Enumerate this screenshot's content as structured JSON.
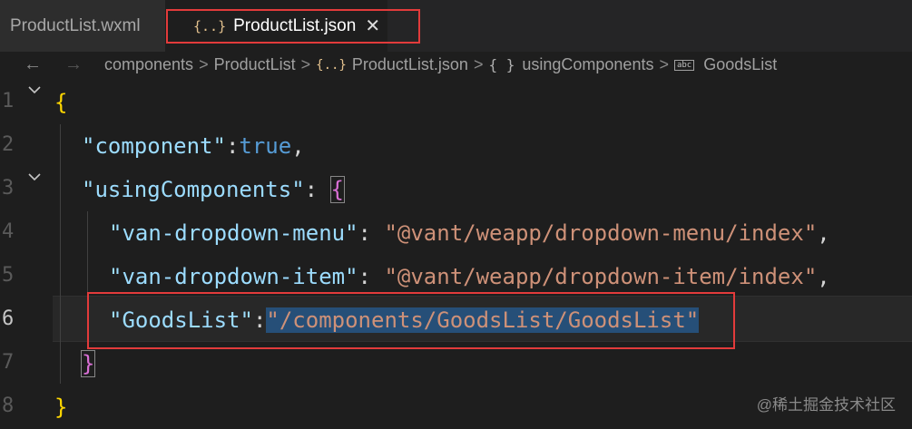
{
  "tabs": [
    {
      "label": "ProductList.wxml",
      "active": false
    },
    {
      "label": "ProductList.json",
      "active": true,
      "icon": "{..}",
      "close": "✕"
    }
  ],
  "nav": {
    "back": "←",
    "forward": "→"
  },
  "breadcrumb": {
    "items": [
      "components",
      "ProductList",
      "ProductList.json",
      "usingComponents",
      "GoodsList"
    ],
    "separator": ">",
    "json_icon": "{..}",
    "object_icon": "{ }",
    "string_icon": "abc"
  },
  "editor": {
    "line_numbers": [
      "1",
      "2",
      "3",
      "4",
      "5",
      "6",
      "7",
      "8"
    ],
    "current_line": "6",
    "lines": {
      "l1_open": "{",
      "l2_key": "\"component\"",
      "l2_colon": ":",
      "l2_value": "true",
      "l2_comma": ",",
      "l3_key": "\"usingComponents\"",
      "l3_colon": ": ",
      "l3_open": "{",
      "l4_key": "\"van-dropdown-menu\"",
      "l4_colon": ": ",
      "l4_value": "\"@vant/weapp/dropdown-menu/index\"",
      "l4_comma": ",",
      "l5_key": "\"van-dropdown-item\"",
      "l5_colon": ": ",
      "l5_value": "\"@vant/weapp/dropdown-item/index\"",
      "l5_comma": ",",
      "l6_key": "\"GoodsList\"",
      "l6_colon": ":",
      "l6_value": "\"/components/GoodsList/GoodsList\"",
      "l7_close": "}",
      "l8_close": "}"
    },
    "fold_icon": "chevron-down"
  },
  "watermark": "@稀土掘金技术社区",
  "colors": {
    "highlight_box": "#e23b3b",
    "selection": "#264f78",
    "string": "#ce9178",
    "key": "#9cdcfe",
    "boolean": "#569cd6",
    "brace_outer": "#ffd700",
    "brace_inner": "#da70d6"
  }
}
